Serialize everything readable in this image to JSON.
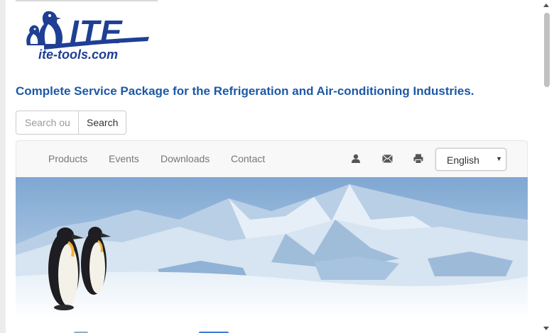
{
  "logo": {
    "brand": "ITE",
    "url": "ite-tools.com"
  },
  "tagline": "Complete Service Package for the Refrigeration and Air-conditioning Industries.",
  "search": {
    "placeholder": "Search our site",
    "button_label": "Search"
  },
  "nav": {
    "items": [
      {
        "label": "Products"
      },
      {
        "label": "Events"
      },
      {
        "label": "Downloads"
      },
      {
        "label": "Contact"
      }
    ],
    "icons": [
      "user-icon",
      "envelope-icon",
      "print-icon"
    ],
    "language": {
      "selected": "English"
    }
  },
  "colors": {
    "tagline": "#1d58a6",
    "logo": "#1f3f94",
    "navbar_bg": "#f8f8f8",
    "nav_text": "#777777"
  }
}
